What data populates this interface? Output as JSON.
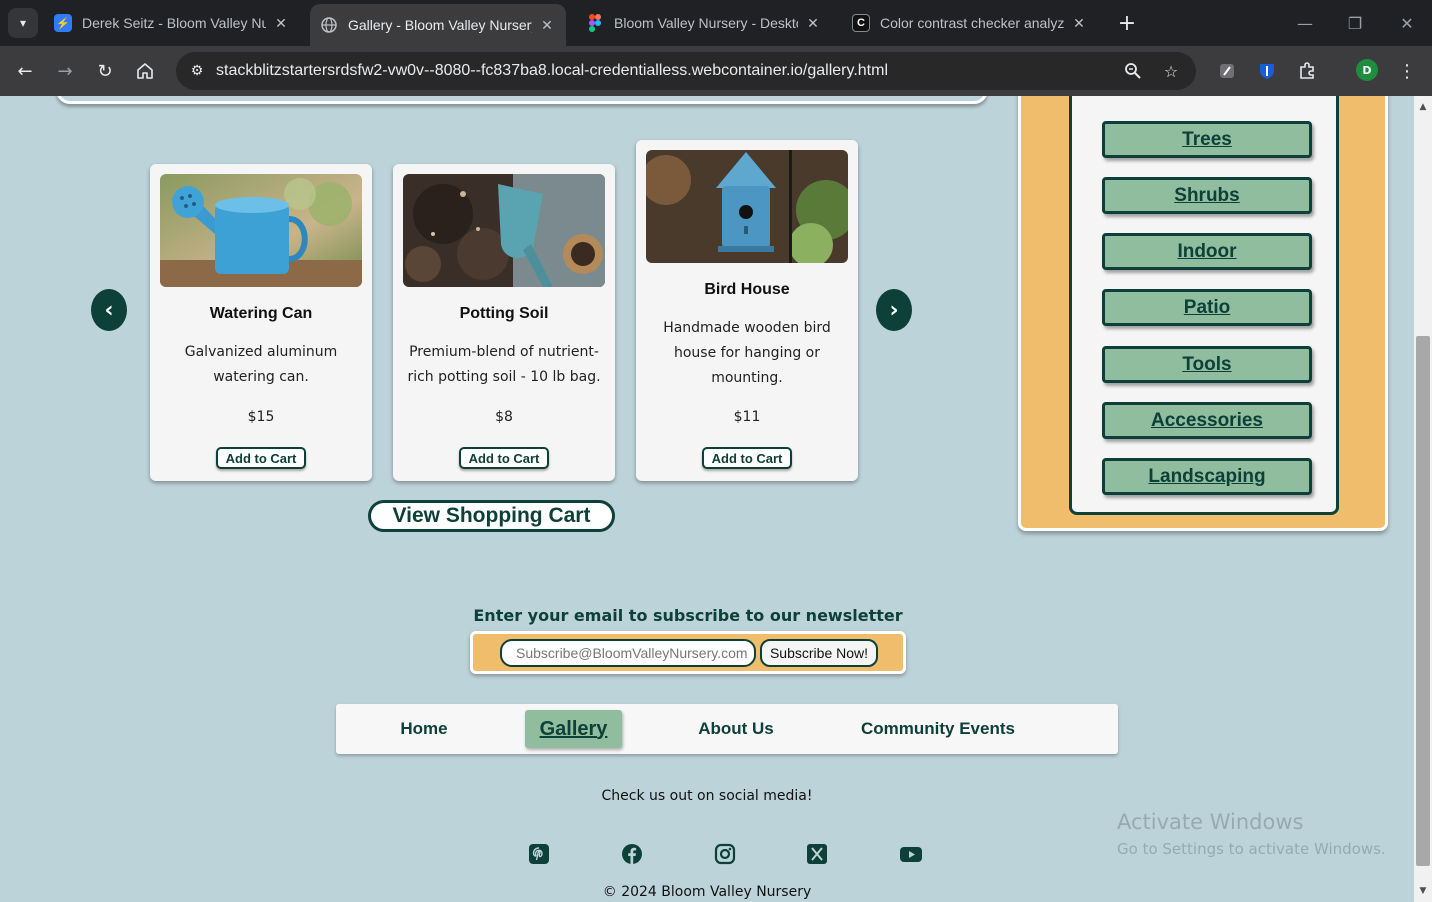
{
  "browser": {
    "tabs": [
      {
        "title": "Derek Seitz - Bloom Valley Nurs",
        "icon": "bolt-icon",
        "active": false
      },
      {
        "title": "Gallery - Bloom Valley Nursery",
        "icon": "globe-icon",
        "active": true
      },
      {
        "title": "Bloom Valley Nursery - Desktop",
        "icon": "figma-icon",
        "active": false
      },
      {
        "title": "Color contrast checker analyzer",
        "icon": "contrast-icon",
        "active": false
      }
    ],
    "url": "stackblitzstartersrdsfw2-vw0v--8080--fc837ba8.local-credentialless.webcontainer.io/gallery.html",
    "profile_initial": "D"
  },
  "gallery": {
    "products": [
      {
        "name": "Watering Can",
        "description": "Galvanized aluminum watering can.",
        "price": "$15",
        "button": "Add to Cart"
      },
      {
        "name": "Potting Soil",
        "description": "Premium-blend of nutrient-rich potting soil - 10 lb bag.",
        "price": "$8",
        "button": "Add to Cart"
      },
      {
        "name": "Bird House",
        "description": "Handmade wooden bird house for hanging or mounting.",
        "price": "$11",
        "button": "Add to Cart"
      }
    ],
    "view_cart": "View Shopping Cart"
  },
  "categories": [
    "Trees",
    "Shrubs",
    "Indoor",
    "Patio",
    "Tools",
    "Accessories",
    "Landscaping"
  ],
  "newsletter": {
    "label": "Enter your email to subscribe to our newsletter",
    "placeholder": "Subscribe@BloomValleyNursery.com",
    "button": "Subscribe Now!"
  },
  "nav": [
    {
      "label": "Home",
      "current": false
    },
    {
      "label": "Gallery",
      "current": true
    },
    {
      "label": "About Us",
      "current": false
    },
    {
      "label": "Community Events",
      "current": false
    }
  ],
  "footer": {
    "social_text": "Check us out on social media!",
    "social_icons": [
      "pinterest-icon",
      "facebook-icon",
      "instagram-icon",
      "x-icon",
      "youtube-icon"
    ],
    "copyright": "© 2024 Bloom Valley Nursery"
  },
  "os_watermark": {
    "title": "Activate Windows",
    "subtitle": "Go to Settings to activate Windows."
  },
  "colors": {
    "page_bg": "#bdd3da",
    "dark_green": "#0d4038",
    "sage": "#8fbd9e",
    "tan": "#efbd6c"
  }
}
